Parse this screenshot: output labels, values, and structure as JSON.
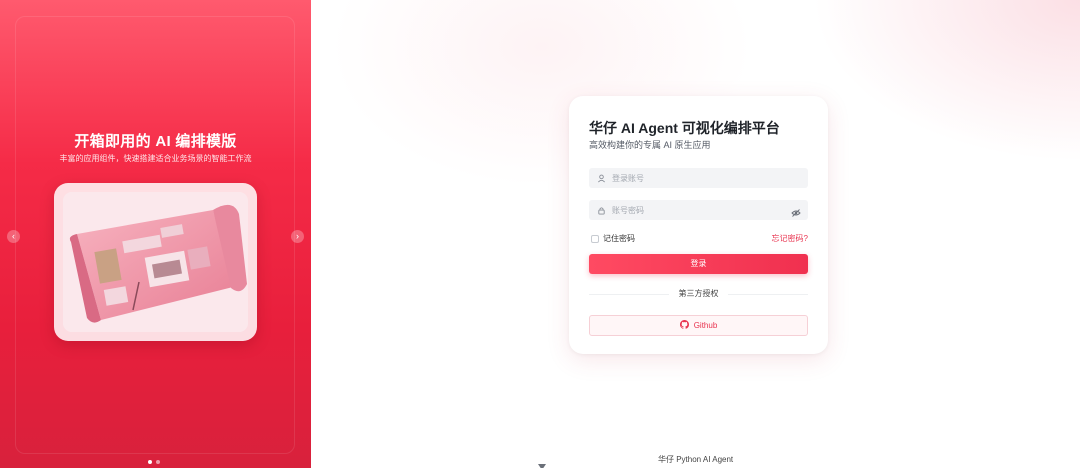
{
  "left_panel": {
    "headline": "开箱即用的 AI 编排模版",
    "subline": "丰富的应用组件，快速搭建适合业务场景的智能工作流",
    "carousel": {
      "slide_count": 2,
      "active_index": 0
    }
  },
  "login": {
    "title": "华仔 AI Agent 可视化编排平台",
    "subtitle": "高效构建你的专属 AI 原生应用",
    "username_placeholder": "登录账号",
    "password_placeholder": "账号密码",
    "remember_label": "记住密码",
    "forgot_label": "忘记密码?",
    "login_button": "登录",
    "third_party_label": "第三方授权",
    "github_label": "Github"
  },
  "footer": {
    "text": "华仔 Python AI Agent"
  },
  "colors": {
    "brand": "#f0304f",
    "accent_light": "#fff6f7"
  },
  "icons": [
    "chevron-left-icon",
    "chevron-right-icon",
    "user-icon",
    "lock-icon",
    "eye-off-icon",
    "github-icon",
    "caret-down-icon"
  ]
}
